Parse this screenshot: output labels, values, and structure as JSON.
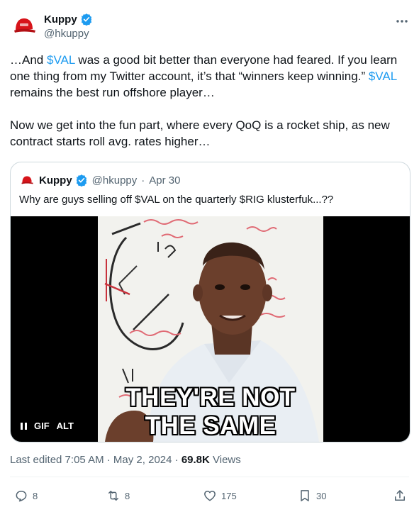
{
  "author": {
    "display_name": "Kuppy",
    "handle": "@hkuppy",
    "verified_icon": "verified-badge-icon",
    "avatar_color": "#d7141a"
  },
  "more_icon": "more-options-icon",
  "body": {
    "p1_s1": "…And ",
    "p1_tag1": "$VAL",
    "p1_s2": " was a good bit better than everyone had feared. If you learn one thing from my Twitter account, it’s that “winners keep winning.” ",
    "p1_tag2": "$VAL",
    "p1_s3": " remains the best run offshore player…",
    "p2": "Now we get into the fun part, where every QoQ is a rocket ship, as new contract starts roll avg. rates higher…"
  },
  "quote": {
    "display_name": "Kuppy",
    "handle": "@hkuppy",
    "separator": "·",
    "date": "Apr 30",
    "text": "Why are guys selling off $VAL on the quarterly $RIG klusterfuk...??",
    "media": {
      "caption_line1": "THEY'RE NOT",
      "caption_line2": "THE SAME",
      "gif_label": "GIF",
      "alt_label": "ALT"
    }
  },
  "meta": {
    "edited": "Last edited 7:05 AM · May 2, 2024 · ",
    "views_count": "69.8K",
    "views_label": " Views"
  },
  "actions": {
    "replies": "8",
    "reposts": "8",
    "likes": "175",
    "bookmarks": "30"
  },
  "colors": {
    "link": "#1d9bf0",
    "text": "#0f1419",
    "secondary": "#536471",
    "border": "#cfd9de"
  }
}
